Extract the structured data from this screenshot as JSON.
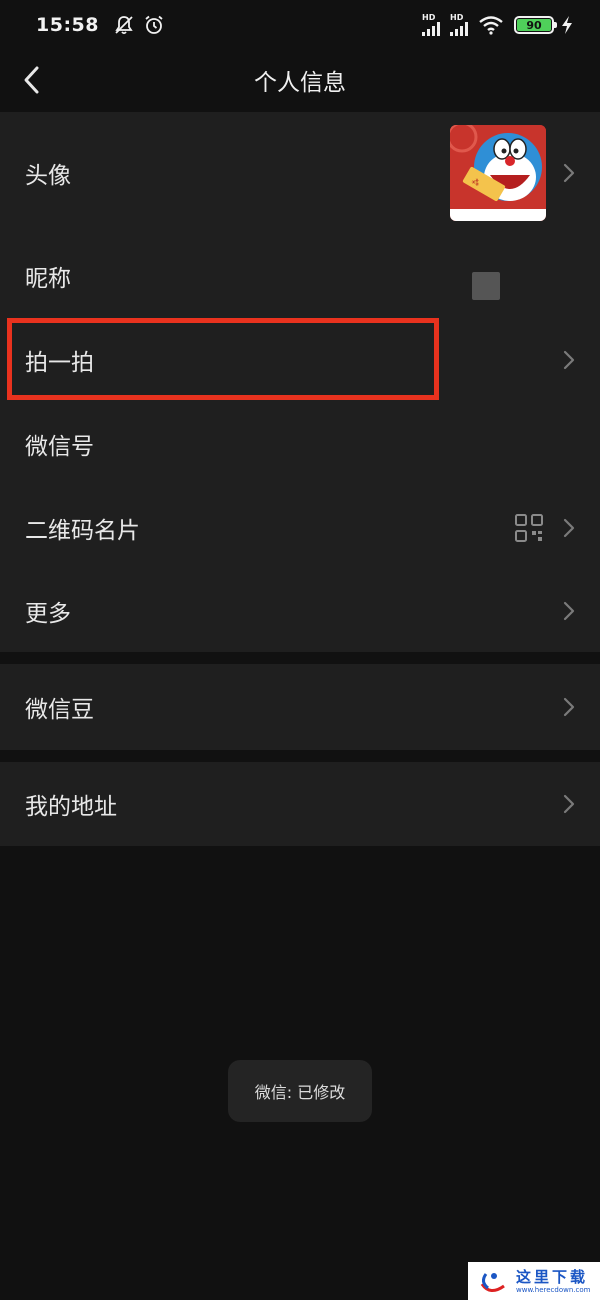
{
  "status_bar": {
    "time": "15:58",
    "icons": [
      "notification-muted-icon",
      "alarm-icon"
    ],
    "signal_1_label": "HD",
    "signal_2_label": "HD",
    "battery_level": "90",
    "battery_color": "#4fd05a"
  },
  "nav": {
    "title": "个人信息",
    "back_icon": "chevron-left-icon"
  },
  "profile_items": [
    {
      "label": "头像",
      "accessory": "avatar-image",
      "has_chevron": true
    },
    {
      "label": "昵称",
      "accessory": "nickname-square",
      "has_chevron": false
    },
    {
      "label": "拍一拍",
      "has_chevron": true,
      "highlighted": true
    },
    {
      "label": "微信号",
      "has_chevron": false
    },
    {
      "label": "二维码名片",
      "accessory": "qr-code-icon",
      "has_chevron": true
    },
    {
      "label": "更多",
      "has_chevron": true
    }
  ],
  "wallet_items": [
    {
      "label": "微信豆",
      "has_chevron": true
    }
  ],
  "address_items": [
    {
      "label": "我的地址",
      "has_chevron": true
    }
  ],
  "toast": {
    "text": "微信: 已修改"
  },
  "watermark": {
    "title": "这里下载",
    "url": "www.herecdown.com"
  },
  "colors": {
    "background": "#111111",
    "group_background": "#1f1f1f",
    "highlight_border": "#e8321e",
    "text": "#e8e8e8",
    "chevron": "#7a7a7a"
  }
}
